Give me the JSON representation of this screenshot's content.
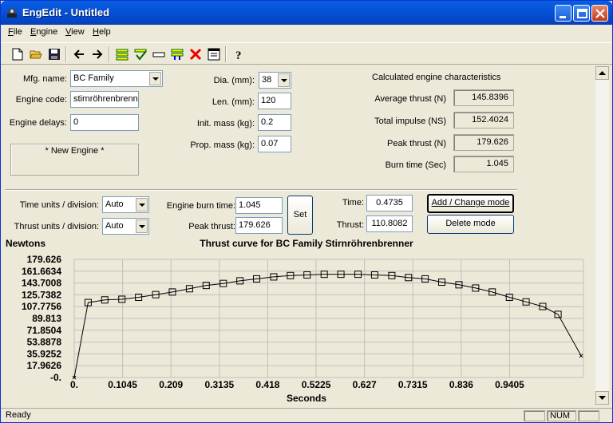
{
  "window": {
    "title": "EngEdit - Untitled"
  },
  "menu": {
    "file": "File",
    "file_key": "F",
    "file_rest": "ile",
    "engine_key": "E",
    "engine_rest": "ngine",
    "view_key": "V",
    "view_rest": "iew",
    "help_key": "H",
    "help_rest": "elp"
  },
  "toolbar": {
    "icons": [
      "new-file-icon",
      "open-folder-icon",
      "save-icon",
      "back-arrow-icon",
      "forward-arrow-icon",
      "list-icon",
      "check-icon",
      "flat-icon",
      "grid-icon",
      "delete-x-icon",
      "window-icon",
      "help-question-icon"
    ]
  },
  "form": {
    "mfg_label": "Mfg. name:",
    "mfg_value": "BC Family",
    "code_label": "Engine code:",
    "code_value": "stirnröhrenbrenner",
    "delays_label": "Engine delays:",
    "delays_value": "0",
    "new_engine": "* New Engine *",
    "dia_label": "Dia. (mm):",
    "dia_value": "38",
    "len_label": "Len. (mm):",
    "len_value": "120",
    "init_label": "Init. mass (kg):",
    "init_value": "0.2",
    "prop_label": "Prop. mass (kg):",
    "prop_value": "0.07"
  },
  "calc": {
    "heading": "Calculated engine characteristics",
    "avg_label": "Average thrust (N)",
    "avg_value": "145.8396",
    "total_label": "Total impulse (NS)",
    "total_value": "152.4024",
    "peak_label": "Peak thrust (N)",
    "peak_value": "179.626",
    "burn_label": "Burn time (Sec)",
    "burn_value": "1.045"
  },
  "controls": {
    "time_units_label": "Time units / division:",
    "time_units_value": "Auto",
    "thrust_units_label": "Thrust units / division:",
    "thrust_units_value": "Auto",
    "burn_label": "Engine burn time:",
    "burn_value": "1.045",
    "peak_label": "Peak thrust:",
    "peak_value": "179.626",
    "set_button": "Set",
    "time_label": "Time:",
    "time_value": "0.4735",
    "thrust_label": "Thrust:",
    "thrust_value": "110.8082",
    "add_change_button": "Add / Change mode",
    "delete_button": "Delete mode"
  },
  "status": {
    "text": "Ready",
    "num": "NUM"
  },
  "colors": {
    "title_blue": "#0653d8",
    "face": "#ece9d8",
    "grid": "#c0c0c0"
  },
  "chart_data": {
    "type": "line",
    "title": "Thrust curve for BC Family Stirnröhrenbrenner",
    "ylabel": "Newtons",
    "xlabel": "Seconds",
    "xlim": [
      0,
      1.1
    ],
    "ylim": [
      0,
      179.626
    ],
    "grid": true,
    "x_ticks": [
      "0.",
      "0.1045",
      "0.209",
      "0.3135",
      "0.418",
      "0.5225",
      "0.627",
      "0.7315",
      "0.836",
      "0.9405"
    ],
    "x_tick_values": [
      0,
      0.1045,
      0.209,
      0.3135,
      0.418,
      0.5225,
      0.627,
      0.7315,
      0.836,
      0.9405
    ],
    "y_ticks": [
      "-0.",
      "17.9626",
      "35.9252",
      "53.8878",
      "71.8504",
      "89.813",
      "107.7756",
      "125.7382",
      "143.7008",
      "161.6634",
      "179.626"
    ],
    "y_tick_values": [
      0,
      17.9626,
      35.9252,
      53.8878,
      71.8504,
      89.813,
      107.7756,
      125.7382,
      143.7008,
      161.6634,
      179.626
    ],
    "x": [
      0,
      0.03,
      0.066,
      0.103,
      0.139,
      0.176,
      0.212,
      0.249,
      0.285,
      0.322,
      0.358,
      0.394,
      0.431,
      0.467,
      0.503,
      0.54,
      0.576,
      0.613,
      0.649,
      0.686,
      0.722,
      0.758,
      0.794,
      0.831,
      0.867,
      0.903,
      0.94,
      0.976,
      1.012,
      1.045,
      1.095
    ],
    "y": [
      0,
      114,
      118,
      119,
      122,
      126,
      130,
      135,
      140,
      143,
      147,
      150,
      153,
      155,
      156,
      157,
      157,
      157,
      156,
      155,
      152,
      150,
      145,
      141,
      136,
      130,
      122,
      115,
      108,
      96,
      33
    ],
    "marker": "square"
  }
}
